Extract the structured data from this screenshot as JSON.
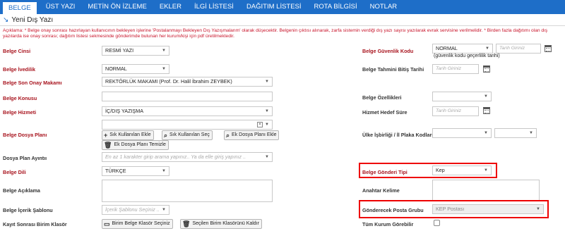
{
  "tabs": [
    "BELGE",
    "ÜST YAZI",
    "METİN ÖN İZLEME",
    "EKLER",
    "İLGİ LİSTESİ",
    "DAĞITIM LİSTESİ",
    "ROTA BİLGİSİ",
    "NOTLAR"
  ],
  "page_title": "Yeni Dış Yazı",
  "note": "Açıklama: * Belge onay sonrası hazırlayan kullanıcının bekleyen işlerine 'Postalanmayı Bekleyen Dış Yazışmalarım' olarak düşecektir. Belgenin çıktısı alınarak, zarfa sistemin verdiği dış yazı sayısı yazılarak evrak servisine verilmelidir. * Birden fazla dağıtımı olan dış yazılarda ise onay sonrası; dağıtım listesi sekmesinde gönderimde bulunan her kurum/kişi için pdf üretilmektedir.",
  "left": {
    "belge_cinsi": {
      "label": "Belge Cinsi",
      "value": "RESMİ YAZI"
    },
    "belge_ivedilik": {
      "label": "Belge İvedilik",
      "value": "NORMAL"
    },
    "son_onay": {
      "label": "Belge Son Onay Makamı",
      "value": "REKTÖRLÜK MAKAMI (Prof. Dr. Halil İbrahim ZEYBEK)"
    },
    "belge_konusu": {
      "label": "Belge Konusu",
      "value": ""
    },
    "belge_hizmeti": {
      "label": "Belge Hizmeti",
      "value": "İÇ/DIŞ YAZIŞMA"
    },
    "dosya_plani": {
      "label": "Belge Dosya Planı",
      "buttons": [
        "Sık Kullanılan Ekle",
        "Sık Kullanılan Seç",
        "Ek Dosya Planı Ekle",
        "Ek Dosya Planı Temizle"
      ]
    },
    "dosya_ayniti": {
      "label": "Dosya Plan Ayıntıı",
      "placeholder": "En az 1 karakter girip arama yapınız.. Ya da elle giriş yapınız .."
    },
    "belge_dili": {
      "label": "Belge Dili",
      "value": "TÜRKÇE"
    },
    "belge_aciklama": {
      "label": "Belge Açıklama"
    },
    "icerik_sablonu": {
      "label": "Belge İçerik Şablonu",
      "placeholder": "İçerik Şablonu Seçiniz .."
    },
    "kayit_sonrasi": {
      "label": "Kayıt Sonrası Birim Klasör",
      "buttons": [
        "Birim Belge Klasör Seçiniz",
        "Seçilen Birim Klasörünü Kaldır"
      ]
    }
  },
  "right": {
    "guvenlik": {
      "label": "Belge Güvenlik Kodu",
      "value": "NORMAL",
      "date_placeholder": "Tarih Giriniz",
      "hint": "(güvenlik kodu geçerlilik tarihi)"
    },
    "tahmini_bitis": {
      "label": "Belge Tahmini Bitiş Tarihi",
      "placeholder": "Tarih Giriniz"
    },
    "ozellikleri": {
      "label": "Belge Özellikleri"
    },
    "hedef_sure": {
      "label": "Hizmet Hedef Süre",
      "placeholder": "Tarih Giriniz"
    },
    "ulke": {
      "label": "Ülke İşbirliği / İl Plaka Kodları"
    },
    "gonderi_tipi": {
      "label": "Belge Gönderi Tipi",
      "value": "Kep"
    },
    "anahtar": {
      "label": "Anahtar Kelime"
    },
    "posta_grubu": {
      "label": "Gönderecek Posta Grubu",
      "value": "KEP Postası"
    },
    "tum_kurum": {
      "label": "Tüm Kurum Görebilir"
    }
  },
  "colors": {
    "tab_bar": "#1e6ec8",
    "label_red": "#a8141e",
    "note_red": "#c8142a",
    "highlight": "#e00000"
  }
}
